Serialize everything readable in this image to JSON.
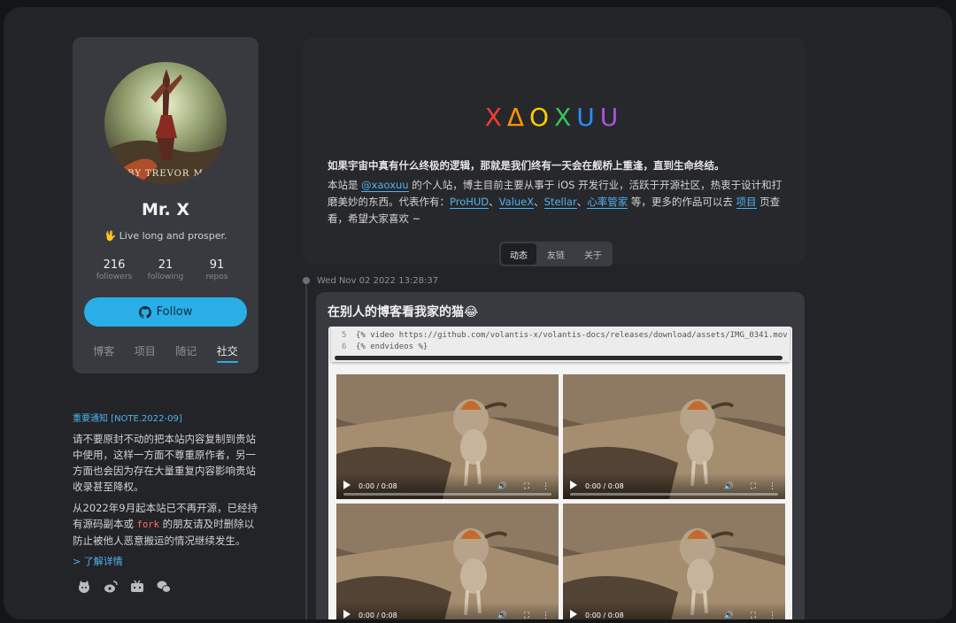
{
  "profile": {
    "name": "Mr. X",
    "bio": "🖖 Live long and prosper.",
    "avatar_caption": "BY TREVOR M",
    "stats": [
      {
        "value": "216",
        "label": "followers"
      },
      {
        "value": "21",
        "label": "following"
      },
      {
        "value": "91",
        "label": "repos"
      }
    ],
    "follow_label": "Follow",
    "nav": [
      {
        "label": "博客",
        "active": false
      },
      {
        "label": "项目",
        "active": false
      },
      {
        "label": "随记",
        "active": false
      },
      {
        "label": "社交",
        "active": true
      }
    ]
  },
  "notice": {
    "title": "重要通知 [NOTE.2022-09]",
    "para1": "请不要原封不动的把本站内容复制到贵站中使用，这样一方面不尊重原作者，另一方面也会因为存在大量重复内容影响贵站收录甚至降权。",
    "para2_a": "从2022年9月起本站已不再开源，已经持有源码副本或 ",
    "para2_code": "fork",
    "para2_b": " 的朋友请及时删除以防止被他人恶意搬运的情况继续发生。",
    "more": "> 了解详情",
    "social_icons": [
      "github-icon",
      "weibo-icon",
      "bilibili-icon",
      "wechat-icon"
    ]
  },
  "header": {
    "logo": [
      "X",
      "Δ",
      "O",
      "X",
      "U",
      "U"
    ],
    "logo_colors": [
      "#ff3b30",
      "#ff9500",
      "#ffcc00",
      "#34c759",
      "#2a8cff",
      "#af52de"
    ],
    "tagline": "如果宇宙中真有什么终极的逻辑，那就是我们终有一天会在舰桥上重逢，直到生命终结。",
    "intro_1": "本站是 ",
    "intro_handle": "@xaoxuu",
    "intro_2": " 的个人站，博主目前主要从事于 iOS 开发行业，活跃于开源社区，热衷于设计和打磨美妙的东西。代表作有：",
    "works": [
      "ProHUD",
      "ValueX",
      "Stellar",
      "心率管家"
    ],
    "sep": "、",
    "intro_3": " 等，更多的作品可以去 ",
    "projects_link": "项目",
    "intro_4": " 页查看，希望大家喜欢 ~",
    "tabs": [
      {
        "label": "动态",
        "active": true
      },
      {
        "label": "友链",
        "active": false
      },
      {
        "label": "关于",
        "active": false
      }
    ]
  },
  "post": {
    "date": "Wed Nov 02 2022 13:28:37",
    "title": "在别人的博客看我家的猫😂",
    "code": [
      {
        "ln": "5",
        "text": "{% video https://github.com/volantis-x/volantis-docs/releases/download/assets/IMG_0341.mov %}"
      },
      {
        "ln": "6",
        "text": "{% endvideos %}"
      }
    ],
    "videos": [
      {
        "time": "0:00 / 0:08",
        "progress": 0
      },
      {
        "time": "0:00 / 0:08",
        "progress": 0
      },
      {
        "time": "0:00 / 0:08",
        "progress": 0
      },
      {
        "time": "0:00 / 0:08",
        "progress": 0
      }
    ]
  }
}
